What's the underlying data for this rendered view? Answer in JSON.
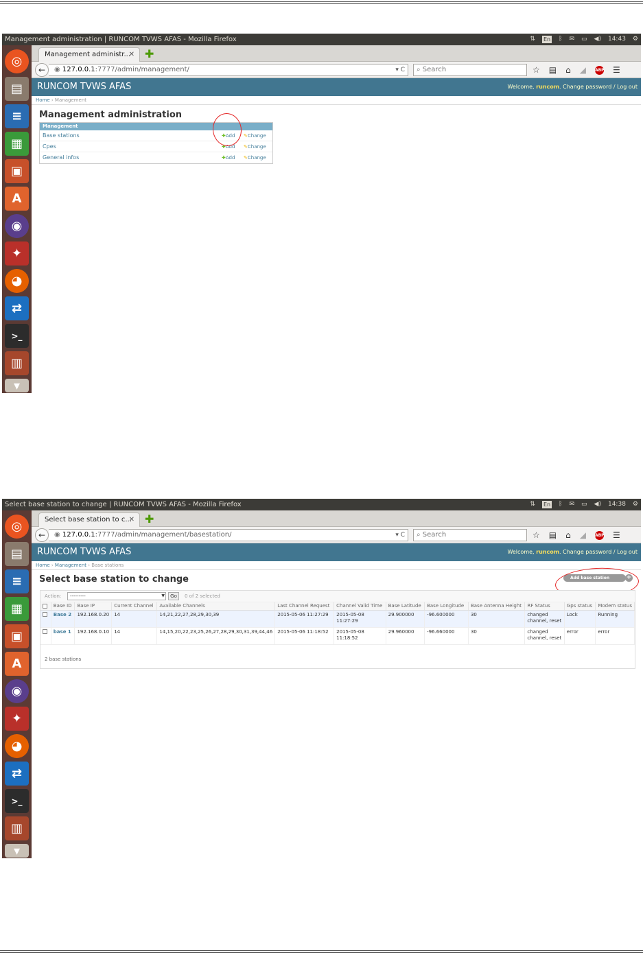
{
  "shot1": {
    "window_title": "Management administration | RUNCOM TVWS AFAS - Mozilla Firefox",
    "tray": {
      "lang": "En",
      "time": "14:43"
    },
    "tab_label": "Management administr...",
    "url_host": "127.0.0.1",
    "url_path": ":7777/admin/management/",
    "search_placeholder": "Search",
    "site_name": "RUNCOM TVWS AFAS",
    "user_welcome": "Welcome,",
    "user_name": "runcom",
    "user_links": ". Change password / Log out",
    "breadcrumb": {
      "home": "Home",
      "sep": " › ",
      "current": "Management"
    },
    "page_title": "Management administration",
    "module_caption": "Management",
    "models": [
      {
        "name": "Base stations",
        "add": "Add",
        "change": "Change"
      },
      {
        "name": "Cpes",
        "add": "Add",
        "change": "Change"
      },
      {
        "name": "General infos",
        "add": "Add",
        "change": "Change"
      }
    ]
  },
  "shot2": {
    "window_title": "Select base station to change | RUNCOM TVWS AFAS - Mozilla Firefox",
    "tray": {
      "lang": "En",
      "time": "14:38"
    },
    "tab_label": "Select base station to c...",
    "url_host": "127.0.0.1",
    "url_path": ":7777/admin/management/basestation/",
    "search_placeholder": "Search",
    "site_name": "RUNCOM TVWS AFAS",
    "user_welcome": "Welcome,",
    "user_name": "runcom",
    "user_links": ". Change password / Log out",
    "breadcrumb": {
      "home": "Home",
      "sep": " › ",
      "mid": "Management",
      "current": "Base stations"
    },
    "page_title": "Select base station to change",
    "add_button": "Add base station",
    "action_label": "Action:",
    "action_selected": "---------",
    "go_label": "Go",
    "selected_count": "0 of 2 selected",
    "columns": [
      "Base ID",
      "Base IP",
      "Current Channel",
      "Available Channels",
      "Last Channel Request",
      "Channel Valid Time",
      "Base Latitude",
      "Base Longitude",
      "Base Antenna Height",
      "RF Status",
      "Gps status",
      "Modem status"
    ],
    "rows": [
      [
        "Base 2",
        "192.168.0.20",
        "14",
        "14,21,22,27,28,29,30,39",
        "2015-05-06 11:27:29",
        "2015-05-08 11:27:29",
        "29.900000",
        "-96.600000",
        "30",
        "changed channel, reset",
        "Lock",
        "Running"
      ],
      [
        "base 1",
        "192.168.0.10",
        "14",
        "14,15,20,22,23,25,26,27,28,29,30,31,39,44,46",
        "2015-05-06 11:18:52",
        "2015-05-08 11:18:52",
        "29.960000",
        "-96.660000",
        "30",
        "changed channel, reset",
        "error",
        "error"
      ]
    ],
    "result_count": "2 base stations"
  },
  "colors": {
    "django_header": "#417690",
    "module_caption": "#79aec8",
    "launcher": "#5b3a34",
    "annotation": "#e52626"
  }
}
